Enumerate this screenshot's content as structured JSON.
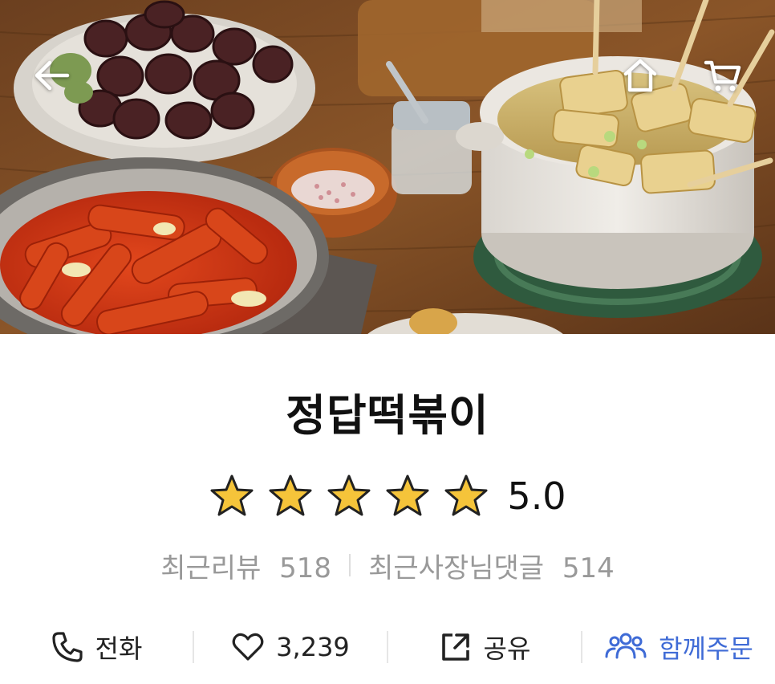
{
  "header": {
    "back_icon": "arrow-left-icon",
    "home_icon": "home-icon",
    "cart_icon": "cart-icon"
  },
  "store": {
    "name": "정답떡볶이",
    "rating": "5.0",
    "rating_stars_filled": 5,
    "rating_stars_total": 5,
    "star_color": "#F5C43A",
    "recent_reviews_label": "최근리뷰",
    "recent_reviews_count": "518",
    "owner_comments_label": "최근사장님댓글",
    "owner_comments_count": "514"
  },
  "actions": {
    "call": {
      "icon": "phone-icon",
      "label": "전화"
    },
    "like": {
      "icon": "heart-icon",
      "label": "3,239"
    },
    "share": {
      "icon": "share-icon",
      "label": "공유"
    },
    "group_order": {
      "icon": "group-icon",
      "label": "함께주문",
      "color": "#3F6BD6"
    }
  }
}
